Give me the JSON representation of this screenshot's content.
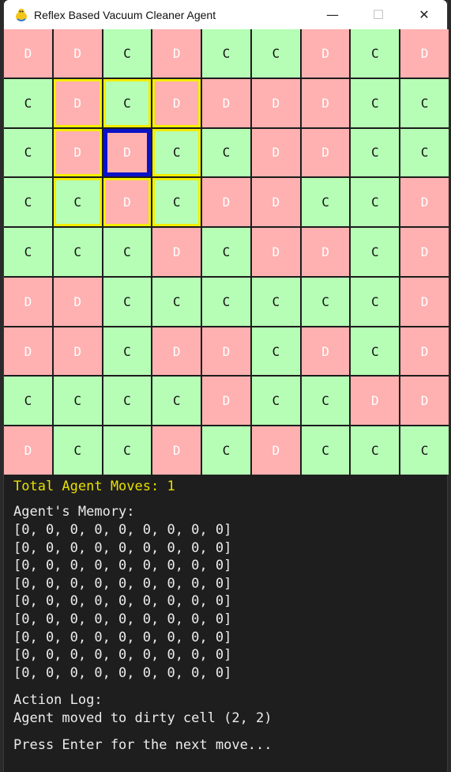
{
  "window": {
    "title": "Reflex Based Vacuum Cleaner Agent",
    "icon": "pygame-snake-icon",
    "controls": [
      "—",
      "☐",
      "✕"
    ]
  },
  "grid": {
    "rows": [
      [
        "D",
        "D",
        "C",
        "D",
        "C",
        "C",
        "D",
        "C",
        "D"
      ],
      [
        "C",
        "D",
        "C",
        "D",
        "D",
        "D",
        "D",
        "C",
        "C"
      ],
      [
        "C",
        "D",
        "D",
        "C",
        "C",
        "D",
        "D",
        "C",
        "C"
      ],
      [
        "C",
        "C",
        "D",
        "C",
        "D",
        "D",
        "C",
        "C",
        "D"
      ],
      [
        "C",
        "C",
        "C",
        "D",
        "C",
        "D",
        "D",
        "C",
        "D"
      ],
      [
        "D",
        "D",
        "C",
        "C",
        "C",
        "C",
        "C",
        "C",
        "D"
      ],
      [
        "D",
        "D",
        "C",
        "D",
        "D",
        "C",
        "D",
        "C",
        "D"
      ],
      [
        "C",
        "C",
        "C",
        "C",
        "D",
        "C",
        "C",
        "D",
        "D"
      ],
      [
        "D",
        "C",
        "C",
        "D",
        "C",
        "D",
        "C",
        "C",
        "C"
      ]
    ],
    "agent": [
      2,
      2
    ],
    "highlight": [
      [
        1,
        1
      ],
      [
        1,
        2
      ],
      [
        1,
        3
      ],
      [
        2,
        1
      ],
      [
        2,
        3
      ],
      [
        3,
        1
      ],
      [
        3,
        2
      ],
      [
        3,
        3
      ]
    ],
    "colors": {
      "clean": "#b6fdb6",
      "dirty": "#ffb0b0",
      "highlight": "#f2ee00",
      "agent": "#0a12c8"
    }
  },
  "status": {
    "moves": "Total Agent Moves: 1",
    "memory_label": "Agent's Memory:",
    "memory_rows": [
      "[0, 0, 0, 0, 0, 0, 0, 0, 0]",
      "[0, 0, 0, 0, 0, 0, 0, 0, 0]",
      "[0, 0, 0, 0, 0, 0, 0, 0, 0]",
      "[0, 0, 0, 0, 0, 0, 0, 0, 0]",
      "[0, 0, 0, 0, 0, 0, 0, 0, 0]",
      "[0, 0, 0, 0, 0, 0, 0, 0, 0]",
      "[0, 0, 0, 0, 0, 0, 0, 0, 0]",
      "[0, 0, 0, 0, 0, 0, 0, 0, 0]",
      "[0, 0, 0, 0, 0, 0, 0, 0, 0]"
    ],
    "log_label": "Action Log:",
    "log_line": "Agent moved to dirty cell (2, 2)",
    "prompt": "Press Enter for the next move..."
  }
}
